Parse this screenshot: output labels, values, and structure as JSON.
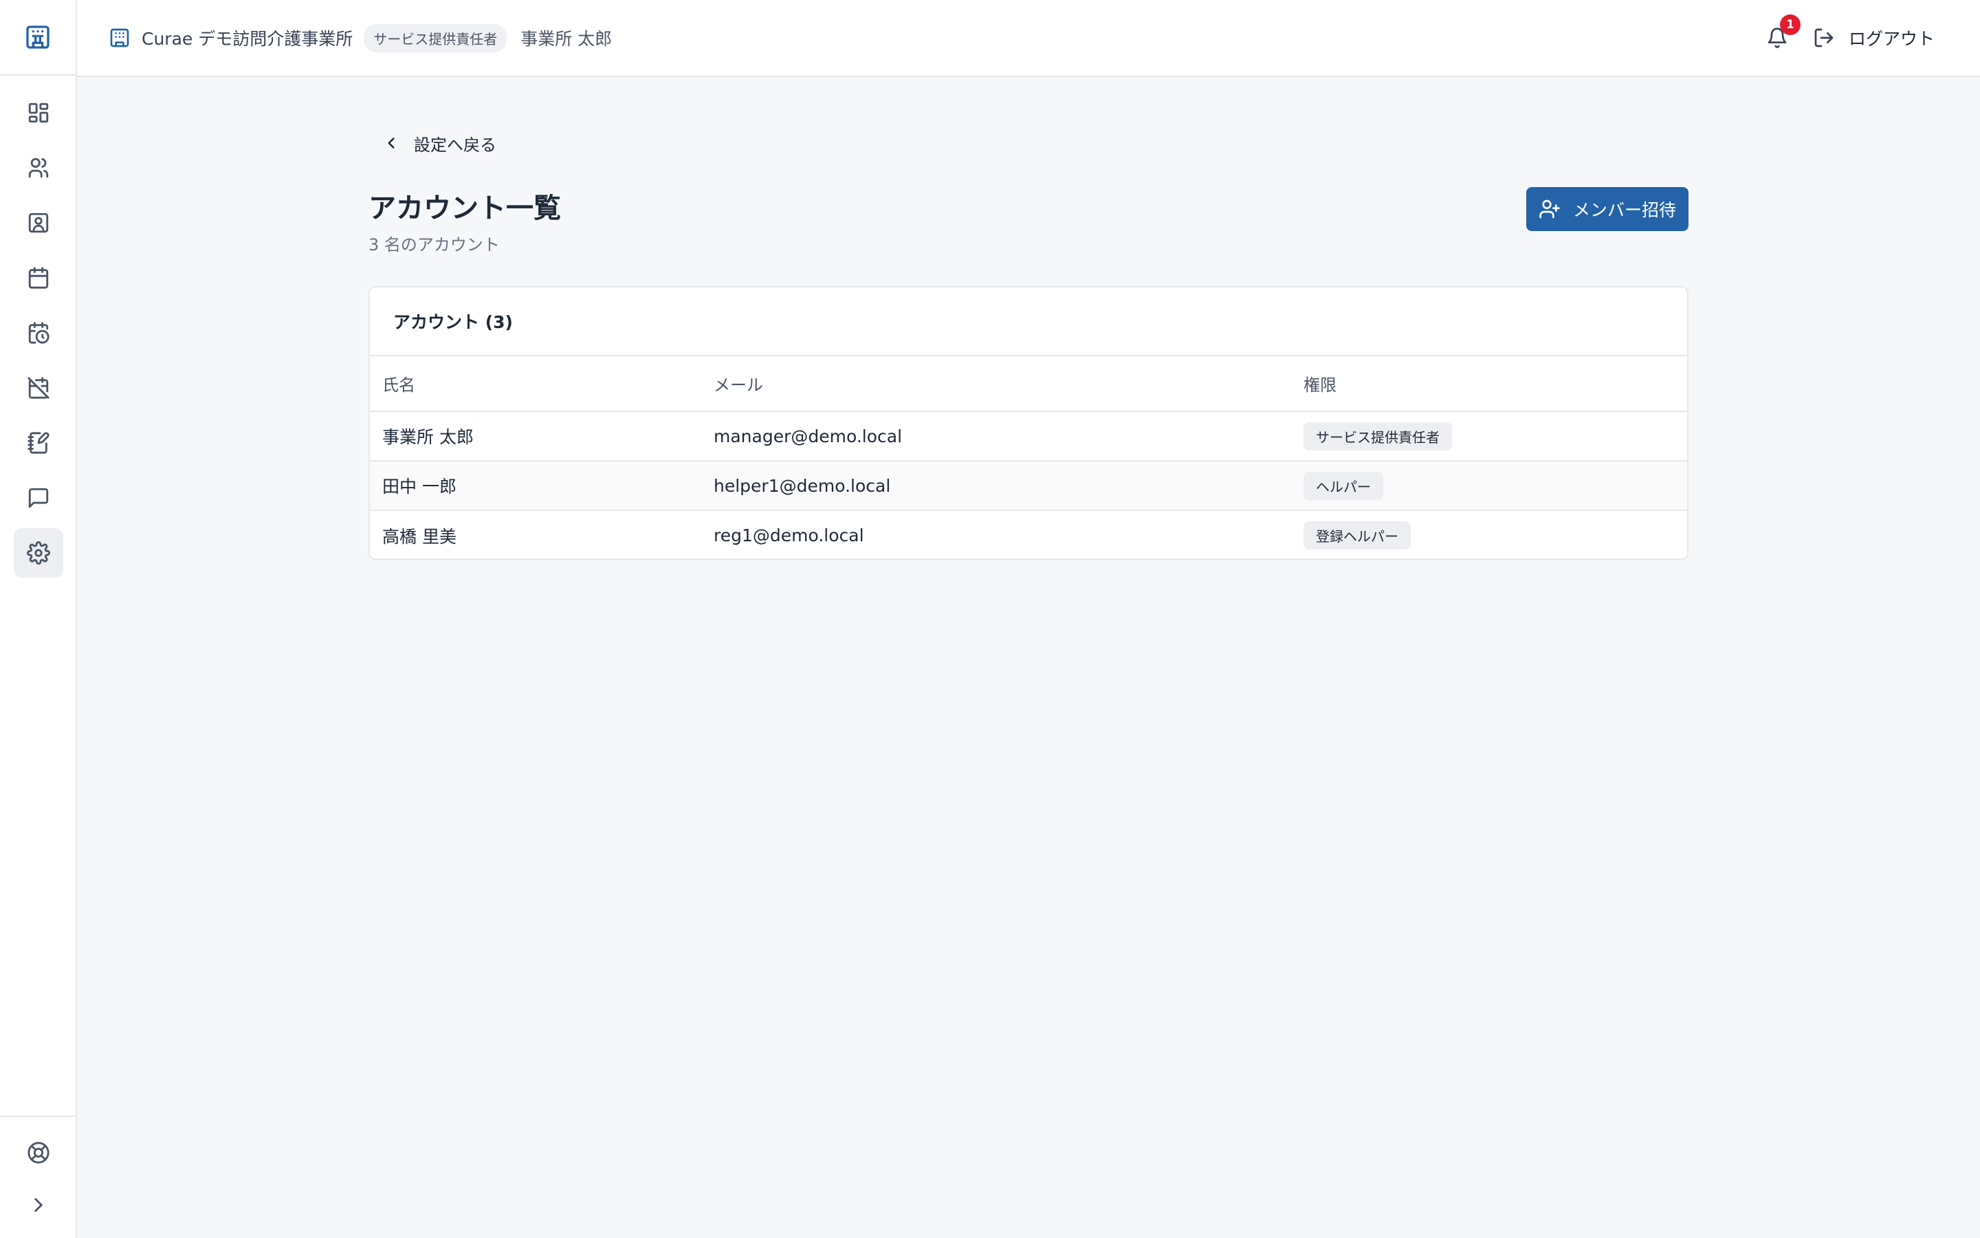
{
  "sidebar": {
    "logo_icon": "building-icon",
    "items": [
      {
        "name": "dashboard",
        "icon": "dashboard-icon",
        "active": false
      },
      {
        "name": "users",
        "icon": "users-icon",
        "active": false
      },
      {
        "name": "contacts",
        "icon": "contact-icon",
        "active": false
      },
      {
        "name": "calendar",
        "icon": "calendar-icon",
        "active": false
      },
      {
        "name": "schedule",
        "icon": "calendar-clock-icon",
        "active": false
      },
      {
        "name": "calendar-off",
        "icon": "calendar-off-icon",
        "active": false
      },
      {
        "name": "records",
        "icon": "notebook-pen-icon",
        "active": false
      },
      {
        "name": "messages",
        "icon": "message-icon",
        "active": false
      },
      {
        "name": "settings",
        "icon": "gear-icon",
        "active": true
      }
    ],
    "help_icon": "lifebuoy-icon",
    "expand_icon": "chevron-right-icon"
  },
  "header": {
    "org_name": "Curae デモ訪問介護事業所",
    "role": "サービス提供責任者",
    "user_name": "事業所 太郎",
    "notification_count": "1",
    "logout_label": "ログアウト"
  },
  "page": {
    "back_label": "設定へ戻る",
    "title": "アカウント一覧",
    "subtitle": "3 名のアカウント",
    "invite_label": "メンバー招待"
  },
  "table": {
    "card_title": "アカウント (3)",
    "columns": [
      "氏名",
      "メール",
      "権限"
    ],
    "rows": [
      {
        "name": "事業所 太郎",
        "email": "manager@demo.local",
        "role": "サービス提供責任者"
      },
      {
        "name": "田中 一郎",
        "email": "helper1@demo.local",
        "role": "ヘルパー"
      },
      {
        "name": "高橋 里美",
        "email": "reg1@demo.local",
        "role": "登録ヘルパー"
      }
    ]
  },
  "colors": {
    "primary": "#2563a8",
    "badge_red": "#e11d2e",
    "background": "#f6f7f9"
  }
}
